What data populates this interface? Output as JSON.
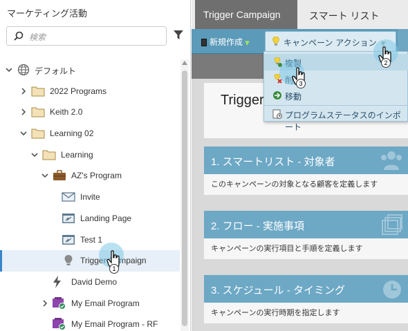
{
  "sidebar": {
    "title": "マーケティング活動",
    "search_placeholder": "検索",
    "items": [
      {
        "label": "デフォルト"
      },
      {
        "label": "2022 Programs"
      },
      {
        "label": "Keith 2.0"
      },
      {
        "label": "Learning 02"
      },
      {
        "label": "Learning"
      },
      {
        "label": "AZ's Program"
      },
      {
        "label": "Invite"
      },
      {
        "label": "Landing Page"
      },
      {
        "label": "Test 1"
      },
      {
        "label": "Trigger Campaign"
      },
      {
        "label": "David Demo"
      },
      {
        "label": "My Email Program"
      },
      {
        "label": "My Email Program - RF"
      }
    ]
  },
  "tabs": [
    {
      "label": "Trigger Campaign"
    },
    {
      "label": "スマート リスト"
    }
  ],
  "toolbar": {
    "new_label": "新規作成",
    "action_label": "キャンペーン アクション"
  },
  "campaign": {
    "title": "Trigger"
  },
  "menu": {
    "items": [
      {
        "label": "複製"
      },
      {
        "label": "削除"
      },
      {
        "label": "移動"
      },
      {
        "label": "プログラムステータスのインポート"
      }
    ]
  },
  "cards": [
    {
      "header": "1. スマートリスト - 対象者",
      "body": "このキャンペーンの対象となる顧客を定義します"
    },
    {
      "header": "2. フロー - 実施事項",
      "body": "キャンペーンの実行項目と手順を定義します"
    },
    {
      "header": "3. スケジュール - タイミング",
      "body": "キャンペーンの実行時期を指定します"
    }
  ],
  "markers": [
    "1",
    "2",
    "3"
  ],
  "colors": {
    "toolbar": "#5b9ab9",
    "card_header": "#6da8c5",
    "active_tab": "#6f6f6f",
    "selection": "#3a86c8"
  }
}
